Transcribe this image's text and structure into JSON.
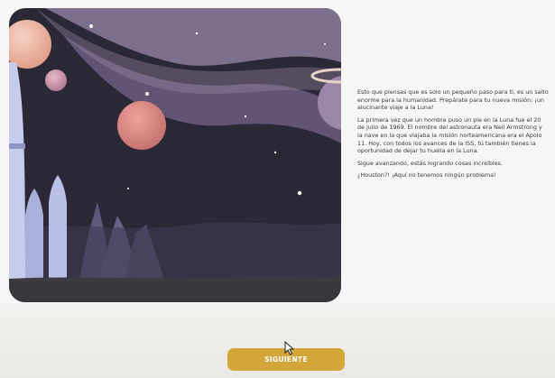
{
  "lesson": {
    "paragraphs": [
      "Esto que piensas que es solo un pequeño paso para ti, es un salto enorme para la humanidad. Prepárate para tu nueva misión: ¡un alucinante viaje a la Luna!",
      "La primera vez que un hombre puso un pie en la Luna fue el 20 de julio de 1969. El nombre del astronauta era Neil Armstrong y la nave en la que viajaba la misión norteamericana era el Apolo 11. Hoy, con todos los avances de la ISS, tú también tienes la oportunidad de dejar tu huella en la Luna.",
      "Sigue avanzando, estás logrando cosas increíbles.",
      "¿Houston?! ¡Aquí no tenemos ningún problema!"
    ]
  },
  "navigation": {
    "next_label": "SIGUIENTE"
  },
  "colors": {
    "space_background": "#2b2935",
    "nebula": "#7a6a8c",
    "ground": "#3c3b40",
    "button": "#d3a63a",
    "rocket": "#b9bfe6"
  },
  "icons": {
    "cursor": "mouse-pointer-icon"
  }
}
